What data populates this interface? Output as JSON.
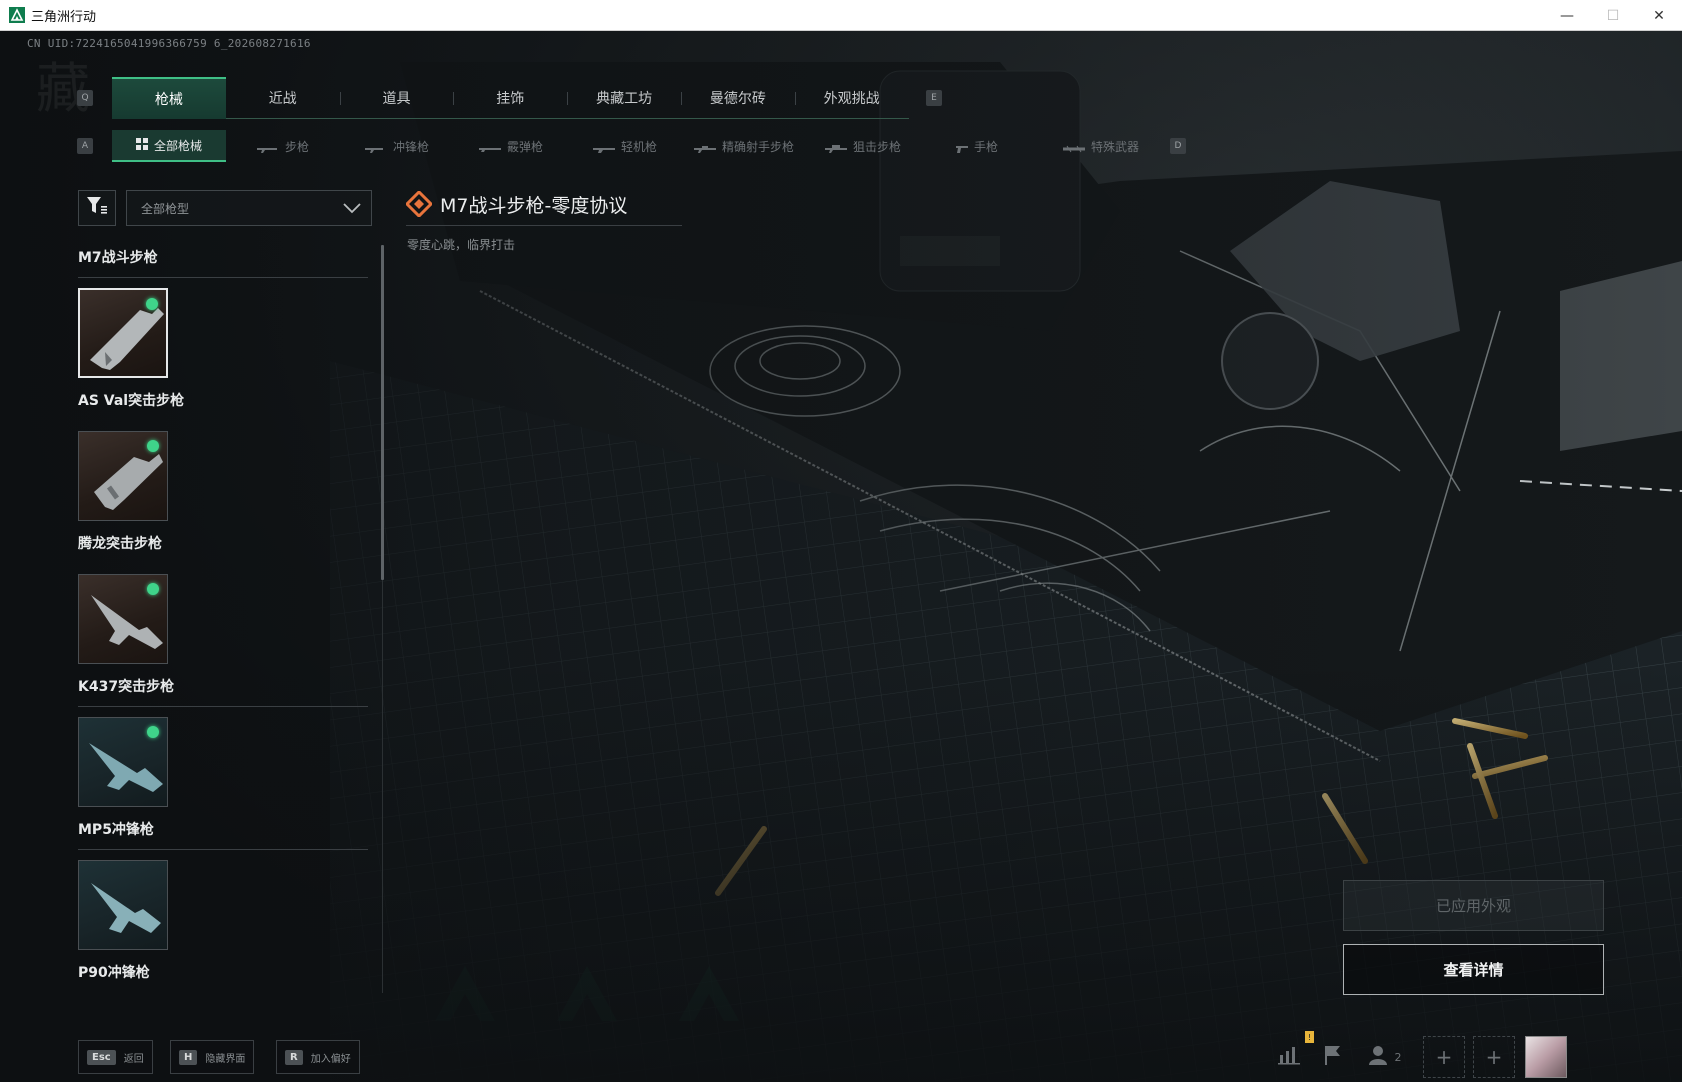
{
  "window": {
    "title": "三角洲行动",
    "controls": [
      "—",
      "☐",
      "✕"
    ]
  },
  "uid_text": "CN UID:7224165041996366759 6_202608271616",
  "deco_char": "藏",
  "tabs": {
    "prev_key": "Q",
    "next_key": "E",
    "items": [
      "枪械",
      "近战",
      "道具",
      "挂饰",
      "典藏工坊",
      "曼德尔砖",
      "外观挑战"
    ],
    "active_index": 0
  },
  "subtabs": {
    "prev_key": "A",
    "next_key": "D",
    "items": [
      "全部枪械",
      "步枪",
      "冲锋枪",
      "霰弹枪",
      "轻机枪",
      "精确射手步枪",
      "狙击步枪",
      "手枪",
      "特殊武器"
    ],
    "active_index": 0
  },
  "filter": {
    "select_value": "全部枪型"
  },
  "weapon_list": [
    {
      "name": "M7战斗步枪",
      "owned": true,
      "selected": true,
      "style": "brown"
    },
    {
      "name": "AS Val突击步枪",
      "owned": true,
      "selected": false,
      "style": "brown"
    },
    {
      "name": "腾龙突击步枪",
      "owned": true,
      "selected": false,
      "style": "brown"
    },
    {
      "name": "K437突击步枪",
      "owned": true,
      "selected": false,
      "style": "teal"
    },
    {
      "name": "MP5冲锋枪",
      "owned": false,
      "selected": false,
      "style": "teal"
    },
    {
      "name": "P90冲锋枪",
      "owned": false,
      "selected": false,
      "style": "brown"
    }
  ],
  "skin": {
    "title": "M7战斗步枪-零度协议",
    "subtitle": "零度心跳，临界打击"
  },
  "buttons": {
    "applied": "已应用外观",
    "details": "查看详情"
  },
  "bottom_hints": [
    {
      "key": "Esc",
      "label": "返回"
    },
    {
      "key": "H",
      "label": "隐藏界面"
    },
    {
      "key": "R",
      "label": "加入偏好"
    }
  ],
  "bottom_right": {
    "stats_icon": "bar-chart-icon",
    "flag_icon": "flag-icon",
    "friends_icon": "user-icon",
    "friends_count": "2",
    "badge": "!",
    "plus": "+"
  },
  "colors": {
    "accent": "#3fbf86",
    "active_tab_bg": "#1a3a31",
    "owned_dot": "#3fd48a",
    "skin_icon": "#e8743c"
  }
}
